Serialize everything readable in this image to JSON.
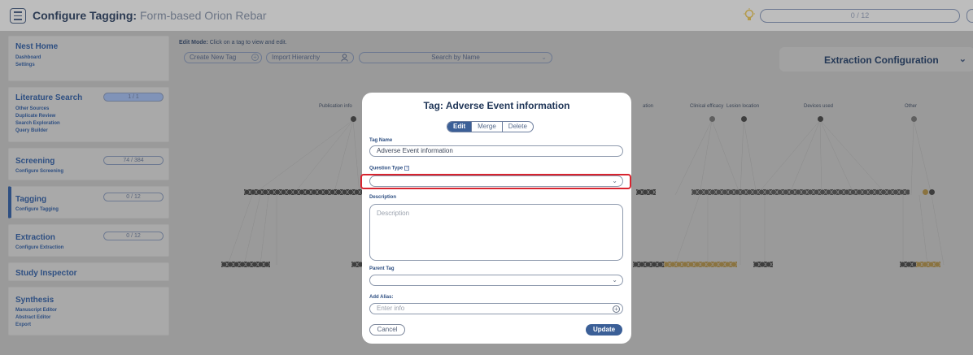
{
  "header": {
    "title_bold": "Configure Tagging:",
    "title_rest": " Form-based Orion Rebar",
    "progress": "0 / 12"
  },
  "sidebar": [
    {
      "title": "Nest Home",
      "subs": [
        "Dashboard",
        "Settings"
      ],
      "pill": ""
    },
    {
      "title": "Literature Search",
      "subs": [
        "Other Sources",
        "Duplicate Review",
        "Search Exploration",
        "Query Builder"
      ],
      "pill": "1 / 1"
    },
    {
      "title": "Screening",
      "subs": [
        "Configure Screening"
      ],
      "pill": "74 / 384"
    },
    {
      "title": "Tagging",
      "subs": [
        "Configure Tagging"
      ],
      "pill": "0 / 12"
    },
    {
      "title": "Extraction",
      "subs": [
        "Configure Extraction"
      ],
      "pill": "0 / 12"
    },
    {
      "title": "Study Inspector",
      "subs": [],
      "pill": ""
    },
    {
      "title": "Synthesis",
      "subs": [
        "Manuscript Editor",
        "Abstract Editor",
        "Export"
      ],
      "pill": ""
    }
  ],
  "toolbar": {
    "edit_mode_bold": "Edit Mode:",
    "edit_mode_text": " Click on a tag to view and edit.",
    "create_new_tag": "Create New Tag",
    "import_hierarchy": "Import Hierarchy",
    "search_placeholder": "Search by Name",
    "extraction_config": "Extraction Configuration"
  },
  "tree": {
    "labels": [
      "Publication info",
      "ation",
      "Clinical efficacy",
      "Lesion location",
      "Devices used",
      "Other"
    ]
  },
  "modal": {
    "title": "Tag: Adverse Event information",
    "tabs": {
      "edit": "Edit",
      "merge": "Merge",
      "delete": "Delete"
    },
    "tag_name_label": "Tag Name",
    "tag_name_value": "Adverse Event information",
    "question_type_label": "Question Type",
    "question_type_value": "",
    "description_label": "Description",
    "description_placeholder": "Description",
    "parent_tag_label": "Parent Tag",
    "parent_tag_value": "",
    "alias_label": "Add Alias:",
    "alias_placeholder": "Enter info",
    "cancel": "Cancel",
    "update": "Update"
  },
  "colors": {
    "accent": "#3b5f97",
    "highlight": "#d8242f",
    "overlay": "#9a9a9a"
  },
  "icons": [
    "menu-icon",
    "lightbulb-icon",
    "plus-circle-icon",
    "person-icon",
    "chevron-down-icon",
    "help-icon"
  ]
}
